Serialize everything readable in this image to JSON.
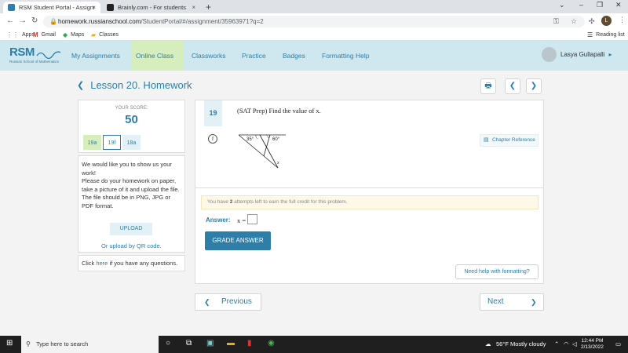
{
  "browser": {
    "tabs": [
      {
        "title": "RSM Student Portal - Assignment",
        "favicon_color": "#2d7ea8",
        "close": "×"
      },
      {
        "title": "Brainly.com - For students",
        "favicon_color": "#222222",
        "close": "×"
      }
    ],
    "new_tab": "+",
    "url_host": "homework.russianschool.com",
    "url_path": "/StudentPortal/#/assignment/35963971?q=2",
    "profile_initial": "L",
    "bookmarks": [
      {
        "label": "Apps",
        "icon": "apps-grid-icon"
      },
      {
        "label": "Gmail",
        "icon": "gmail-icon"
      },
      {
        "label": "Maps",
        "icon": "maps-icon"
      },
      {
        "label": "Classes",
        "icon": "folder-icon"
      }
    ],
    "reading_list": "Reading list"
  },
  "site": {
    "logo": "RSM",
    "logo_sub": "Russian School of Mathematics",
    "nav": [
      "My Assignments",
      "Online Class",
      "Classworks",
      "Practice",
      "Badges",
      "Formatting Help"
    ],
    "active_nav": "Online Class",
    "user_name": "Lasya Gullapalli"
  },
  "lesson": {
    "title": "Lesson 20. Homework"
  },
  "score": {
    "label": "YOUR SCORE:",
    "value": "50"
  },
  "question_tabs": [
    "19a",
    "19f",
    "18a"
  ],
  "instructions": {
    "line1": "We would like you to show us your work!",
    "line2": "Please do your homework on paper, take a picture of it and upload the file.",
    "line3": "The file should be in PNG, JPG or PDF format.",
    "upload": "UPLOAD",
    "qr": "Or upload by QR code.",
    "help_pre": "Click ",
    "help_link": "here",
    "help_post": " if you have any questions."
  },
  "question": {
    "number": "19",
    "prompt": "(SAT Prep) Find the value of x.",
    "f_label": "f",
    "chapter_ref": "Chapter Reference",
    "figure": {
      "angle1": "35°",
      "angle2": "60°",
      "unknown": "x"
    },
    "attempts_pre": "You have ",
    "attempts_num": "2",
    "attempts_post": " attempts left to earn the full credit for this problem.",
    "answer_label": "Answer:",
    "answer_var": "x =",
    "grade_button": "GRADE ANSWER",
    "format_help": "Need help with formatting?"
  },
  "pager": {
    "prev": "Previous",
    "next": "Next"
  },
  "taskbar": {
    "search_placeholder": "Type here to search",
    "weather": "56°F  Mostly cloudy",
    "time": "12:44 PM",
    "date": "2/13/2022"
  },
  "colors": {
    "brand": "#2d7ea8",
    "header_bg": "#cfe8f0",
    "active_nav": "#d6edbd"
  }
}
